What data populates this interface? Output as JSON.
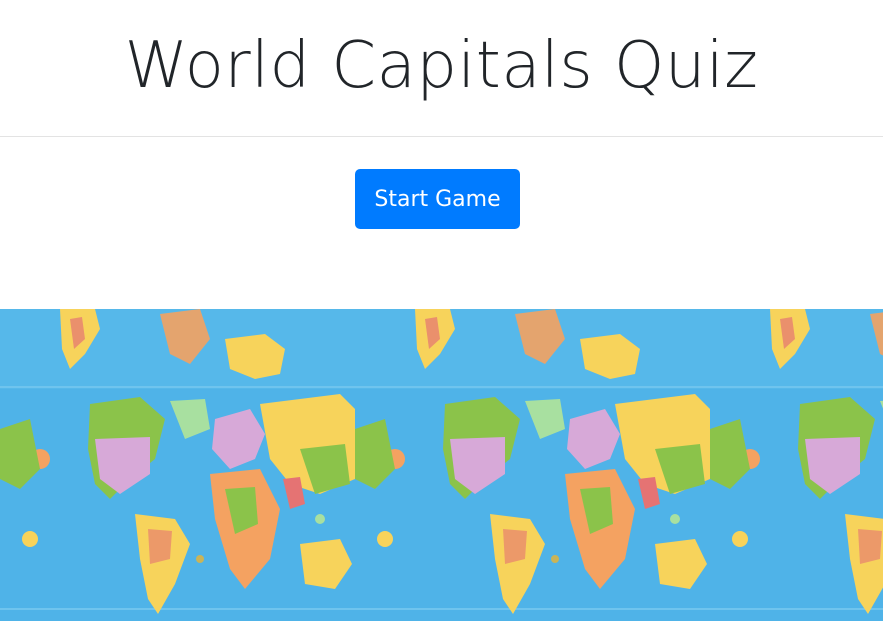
{
  "page": {
    "title": "World Capitals Quiz"
  },
  "controls": {
    "start_label": "Start Game"
  },
  "theme": {
    "accent": "#007bff",
    "ocean": "#4fb3e8",
    "land_colors": [
      "#f7d35b",
      "#8bc34a",
      "#d7a9d8",
      "#f4a261",
      "#a8e0a0",
      "#e57373",
      "#c9b458"
    ]
  },
  "background": {
    "image": "tiled world political map"
  }
}
